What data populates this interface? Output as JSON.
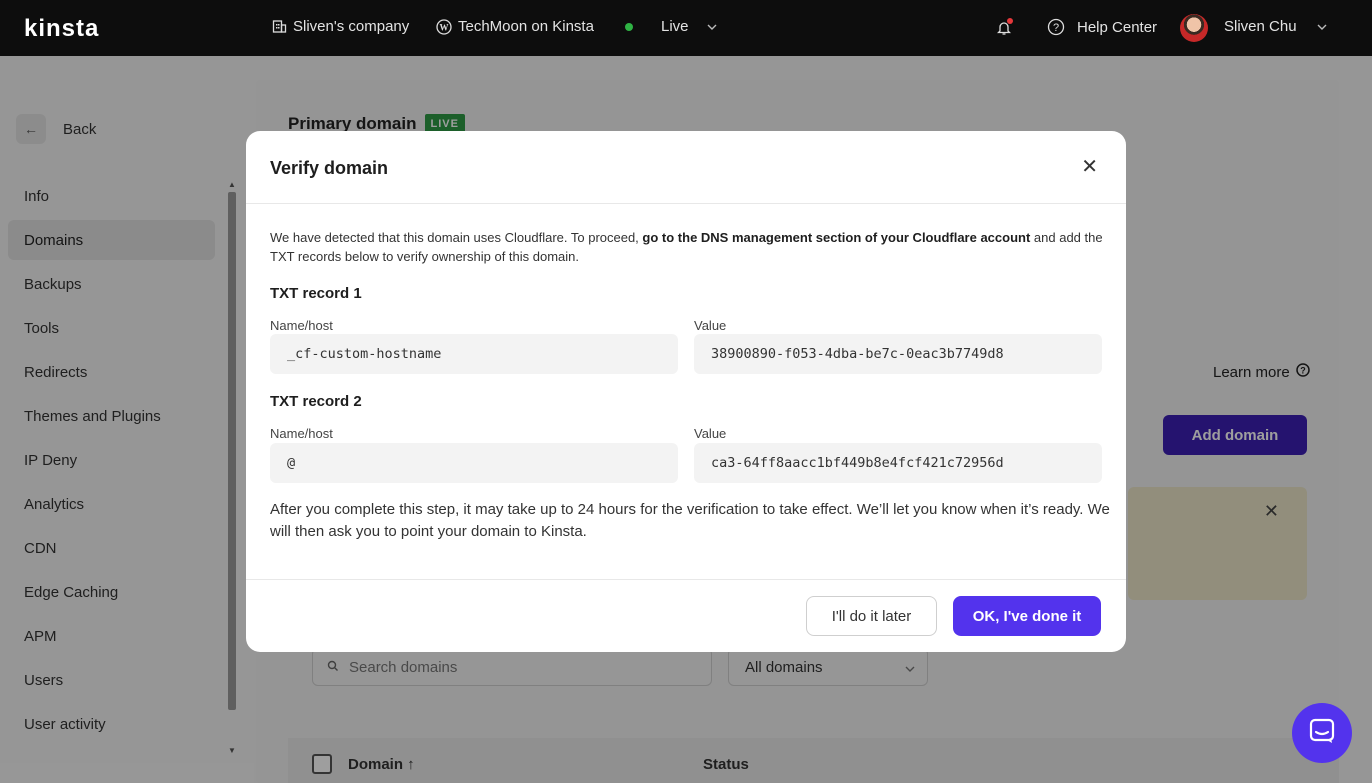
{
  "topbar": {
    "logo": "kinsta",
    "company": "Sliven's company",
    "site": "TechMoon on Kinsta",
    "environment": "Live",
    "help": "Help Center",
    "user": "Sliven Chu"
  },
  "sidebar": {
    "back_label": "Back",
    "items": [
      {
        "label": "Info"
      },
      {
        "label": "Domains"
      },
      {
        "label": "Backups"
      },
      {
        "label": "Tools"
      },
      {
        "label": "Redirects"
      },
      {
        "label": "Themes and Plugins"
      },
      {
        "label": "IP Deny"
      },
      {
        "label": "Analytics"
      },
      {
        "label": "CDN"
      },
      {
        "label": "Edge Caching"
      },
      {
        "label": "APM"
      },
      {
        "label": "Users"
      },
      {
        "label": "User activity"
      }
    ]
  },
  "main": {
    "primary_domain_title": "Primary domain",
    "live_badge": "LIVE",
    "learn_more": "Learn more",
    "add_domain": "Add domain",
    "search_placeholder": "Search domains",
    "filter_selected": "All domains",
    "table": {
      "col_domain": "Domain ↑",
      "col_status": "Status"
    }
  },
  "modal": {
    "title": "Verify domain",
    "intro_pre": "We have detected that this domain uses Cloudflare. To proceed, ",
    "intro_bold": "go to the DNS management section of your Cloudflare account",
    "intro_post": " and add the TXT records below to verify ownership of this domain.",
    "records": [
      {
        "title": "TXT record 1",
        "name_label": "Name/host",
        "name_value": "_cf-custom-hostname",
        "value_label": "Value",
        "value": "38900890-f053-4dba-be7c-0eac3b7749d8"
      },
      {
        "title": "TXT record 2",
        "name_label": "Name/host",
        "name_value": "@",
        "value_label": "Value",
        "value": "ca3-64ff8aacc1bf449b8e4fcf421c72956d"
      }
    ],
    "after_text": "After you complete this step, it may take up to 24 hours for the verification to take effect. We’ll let you know when it’s ready. We will then ask you to point your domain to Kinsta.",
    "later_button": "I'll do it later",
    "ok_button": "OK, I've done it"
  },
  "colors": {
    "accent": "#5333ed",
    "topbar_bg": "#0d0d0d",
    "live_green": "#2e9a44"
  }
}
